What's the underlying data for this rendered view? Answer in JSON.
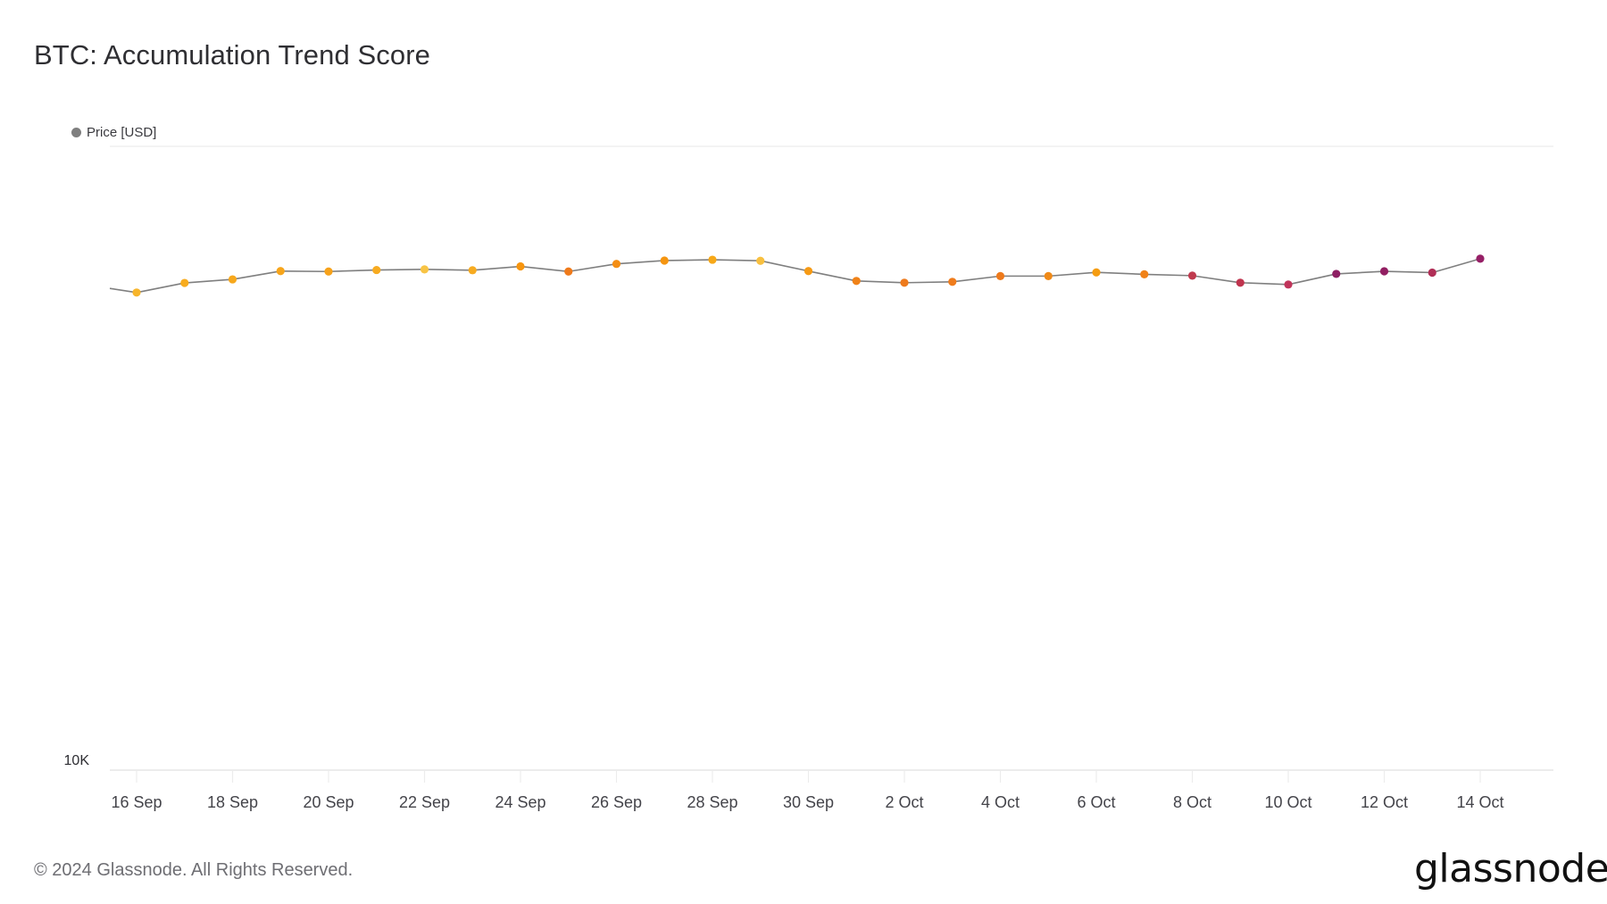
{
  "header": {
    "title": "BTC: Accumulation Trend Score"
  },
  "legend": {
    "items": [
      {
        "label": "Price [USD]",
        "color": "#7f7f7f"
      }
    ]
  },
  "footer": {
    "copyright": "© 2024 Glassnode. All Rights Reserved.",
    "logo": "glassnode"
  },
  "chart_data": {
    "type": "line",
    "title": "BTC: Accumulation Trend Score",
    "xlabel": "",
    "ylabel": "",
    "y_scale": "log",
    "ylim": [
      10000,
      100000
    ],
    "y_tick_labels": [
      "10K"
    ],
    "x_tick_labels": [
      "16 Sep",
      "18 Sep",
      "20 Sep",
      "22 Sep",
      "24 Sep",
      "26 Sep",
      "28 Sep",
      "30 Sep",
      "2 Oct",
      "4 Oct",
      "6 Oct",
      "8 Oct",
      "10 Oct",
      "12 Oct",
      "14 Oct"
    ],
    "grid": "horizontal",
    "legend_position": "top-left",
    "line_color": "#7f7f7f",
    "series": [
      {
        "name": "Price [USD]",
        "x": [
          "15 Sep",
          "16 Sep",
          "17 Sep",
          "18 Sep",
          "19 Sep",
          "20 Sep",
          "21 Sep",
          "22 Sep",
          "23 Sep",
          "24 Sep",
          "25 Sep",
          "26 Sep",
          "27 Sep",
          "28 Sep",
          "29 Sep",
          "30 Sep",
          "1 Oct",
          "2 Oct",
          "3 Oct",
          "4 Oct",
          "5 Oct",
          "6 Oct",
          "7 Oct",
          "8 Oct",
          "9 Oct",
          "10 Oct",
          "11 Oct",
          "12 Oct",
          "13 Oct",
          "14 Oct"
        ],
        "values": [
          59200,
          58300,
          60400,
          61200,
          63100,
          63000,
          63350,
          63500,
          63300,
          64200,
          63000,
          64800,
          65600,
          65800,
          65550,
          63100,
          60850,
          60450,
          60650,
          61950,
          61950,
          62800,
          62350,
          62050,
          60450,
          60050,
          62450,
          63050,
          62750,
          66050
        ],
        "point_colors": [
          null,
          "#f7b52b",
          "#f8ac1e",
          "#f7a81c",
          "#f7a51b",
          "#f7a21a",
          "#f7ab21",
          "#f8c445",
          "#f7ab21",
          "#f7950e",
          "#ef7a1a",
          "#f48e14",
          "#f59510",
          "#f7a818",
          "#f8c040",
          "#f69a14",
          "#f08218",
          "#ee7a1c",
          "#ef7c1c",
          "#ee7a1c",
          "#f08a18",
          "#f59c10",
          "#f08218",
          "#c03a4e",
          "#c0344e",
          "#c0345a",
          "#8e1f63",
          "#921f62",
          "#b02e56",
          "#961f66"
        ]
      }
    ]
  }
}
